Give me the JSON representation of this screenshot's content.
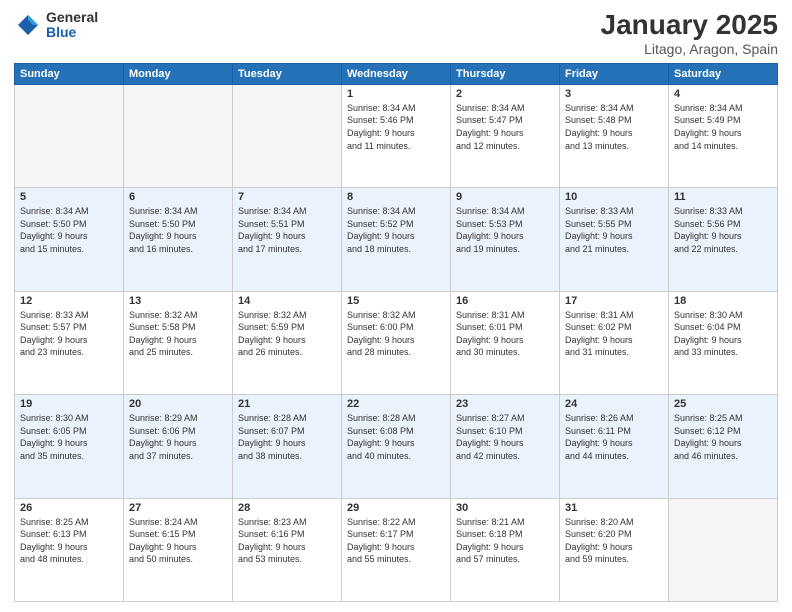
{
  "header": {
    "logo_general": "General",
    "logo_blue": "Blue",
    "month_title": "January 2025",
    "location": "Litago, Aragon, Spain"
  },
  "calendar": {
    "days_of_week": [
      "Sunday",
      "Monday",
      "Tuesday",
      "Wednesday",
      "Thursday",
      "Friday",
      "Saturday"
    ],
    "weeks": [
      [
        {
          "day": "",
          "empty": true
        },
        {
          "day": "",
          "empty": true
        },
        {
          "day": "",
          "empty": true
        },
        {
          "day": "1",
          "sunrise": "8:34 AM",
          "sunset": "5:46 PM",
          "daylight": "9 hours and 11 minutes."
        },
        {
          "day": "2",
          "sunrise": "8:34 AM",
          "sunset": "5:47 PM",
          "daylight": "9 hours and 12 minutes."
        },
        {
          "day": "3",
          "sunrise": "8:34 AM",
          "sunset": "5:48 PM",
          "daylight": "9 hours and 13 minutes."
        },
        {
          "day": "4",
          "sunrise": "8:34 AM",
          "sunset": "5:49 PM",
          "daylight": "9 hours and 14 minutes."
        }
      ],
      [
        {
          "day": "5",
          "sunrise": "8:34 AM",
          "sunset": "5:50 PM",
          "daylight": "9 hours and 15 minutes."
        },
        {
          "day": "6",
          "sunrise": "8:34 AM",
          "sunset": "5:50 PM",
          "daylight": "9 hours and 16 minutes."
        },
        {
          "day": "7",
          "sunrise": "8:34 AM",
          "sunset": "5:51 PM",
          "daylight": "9 hours and 17 minutes."
        },
        {
          "day": "8",
          "sunrise": "8:34 AM",
          "sunset": "5:52 PM",
          "daylight": "9 hours and 18 minutes."
        },
        {
          "day": "9",
          "sunrise": "8:34 AM",
          "sunset": "5:53 PM",
          "daylight": "9 hours and 19 minutes."
        },
        {
          "day": "10",
          "sunrise": "8:33 AM",
          "sunset": "5:55 PM",
          "daylight": "9 hours and 21 minutes."
        },
        {
          "day": "11",
          "sunrise": "8:33 AM",
          "sunset": "5:56 PM",
          "daylight": "9 hours and 22 minutes."
        }
      ],
      [
        {
          "day": "12",
          "sunrise": "8:33 AM",
          "sunset": "5:57 PM",
          "daylight": "9 hours and 23 minutes."
        },
        {
          "day": "13",
          "sunrise": "8:32 AM",
          "sunset": "5:58 PM",
          "daylight": "9 hours and 25 minutes."
        },
        {
          "day": "14",
          "sunrise": "8:32 AM",
          "sunset": "5:59 PM",
          "daylight": "9 hours and 26 minutes."
        },
        {
          "day": "15",
          "sunrise": "8:32 AM",
          "sunset": "6:00 PM",
          "daylight": "9 hours and 28 minutes."
        },
        {
          "day": "16",
          "sunrise": "8:31 AM",
          "sunset": "6:01 PM",
          "daylight": "9 hours and 30 minutes."
        },
        {
          "day": "17",
          "sunrise": "8:31 AM",
          "sunset": "6:02 PM",
          "daylight": "9 hours and 31 minutes."
        },
        {
          "day": "18",
          "sunrise": "8:30 AM",
          "sunset": "6:04 PM",
          "daylight": "9 hours and 33 minutes."
        }
      ],
      [
        {
          "day": "19",
          "sunrise": "8:30 AM",
          "sunset": "6:05 PM",
          "daylight": "9 hours and 35 minutes."
        },
        {
          "day": "20",
          "sunrise": "8:29 AM",
          "sunset": "6:06 PM",
          "daylight": "9 hours and 37 minutes."
        },
        {
          "day": "21",
          "sunrise": "8:28 AM",
          "sunset": "6:07 PM",
          "daylight": "9 hours and 38 minutes."
        },
        {
          "day": "22",
          "sunrise": "8:28 AM",
          "sunset": "6:08 PM",
          "daylight": "9 hours and 40 minutes."
        },
        {
          "day": "23",
          "sunrise": "8:27 AM",
          "sunset": "6:10 PM",
          "daylight": "9 hours and 42 minutes."
        },
        {
          "day": "24",
          "sunrise": "8:26 AM",
          "sunset": "6:11 PM",
          "daylight": "9 hours and 44 minutes."
        },
        {
          "day": "25",
          "sunrise": "8:25 AM",
          "sunset": "6:12 PM",
          "daylight": "9 hours and 46 minutes."
        }
      ],
      [
        {
          "day": "26",
          "sunrise": "8:25 AM",
          "sunset": "6:13 PM",
          "daylight": "9 hours and 48 minutes."
        },
        {
          "day": "27",
          "sunrise": "8:24 AM",
          "sunset": "6:15 PM",
          "daylight": "9 hours and 50 minutes."
        },
        {
          "day": "28",
          "sunrise": "8:23 AM",
          "sunset": "6:16 PM",
          "daylight": "9 hours and 53 minutes."
        },
        {
          "day": "29",
          "sunrise": "8:22 AM",
          "sunset": "6:17 PM",
          "daylight": "9 hours and 55 minutes."
        },
        {
          "day": "30",
          "sunrise": "8:21 AM",
          "sunset": "6:18 PM",
          "daylight": "9 hours and 57 minutes."
        },
        {
          "day": "31",
          "sunrise": "8:20 AM",
          "sunset": "6:20 PM",
          "daylight": "9 hours and 59 minutes."
        },
        {
          "day": "",
          "empty": true
        }
      ]
    ],
    "labels": {
      "sunrise": "Sunrise:",
      "sunset": "Sunset:",
      "daylight": "Daylight:"
    }
  }
}
